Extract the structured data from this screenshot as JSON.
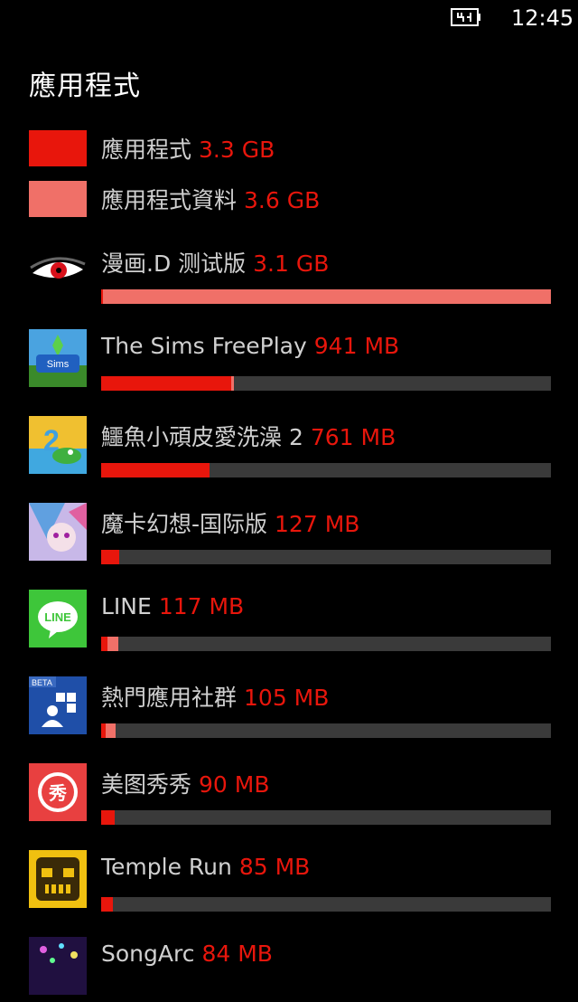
{
  "status": {
    "time": "12:45",
    "battery_icon": "battery-charging-icon"
  },
  "page": {
    "title": "應用程式"
  },
  "colors": {
    "app": "#e8160c",
    "data": "#f07068",
    "track": "#3a3a3a",
    "background": "#000000"
  },
  "legend": [
    {
      "name": "應用程式",
      "size": "3.3 GB",
      "color": "#e8160c"
    },
    {
      "name": "應用程式資料",
      "size": "3.6 GB",
      "color": "#f07068"
    }
  ],
  "apps": [
    {
      "name": "漫画.D 测试版",
      "size": "3.1 GB",
      "icon": "manga-d-eye-icon",
      "app_fraction": 0.004,
      "data_fraction": 0.996
    },
    {
      "name": "The Sims FreePlay",
      "size": "941 MB",
      "icon": "sims-freeplay-icon",
      "app_fraction": 0.29,
      "data_fraction": 0.005
    },
    {
      "name": "鱷魚小頑皮愛洗澡 2",
      "size": "761 MB",
      "icon": "wheres-my-water-icon",
      "app_fraction": 0.24,
      "data_fraction": 0.0
    },
    {
      "name": "魔卡幻想-国际版",
      "size": "127 MB",
      "icon": "magic-card-fantasy-icon",
      "app_fraction": 0.04,
      "data_fraction": 0.0
    },
    {
      "name": "LINE",
      "size": "117 MB",
      "icon": "line-icon",
      "app_fraction": 0.014,
      "data_fraction": 0.025
    },
    {
      "name": "熱門應用社群",
      "size": "105 MB",
      "icon": "app-social-beta-icon",
      "app_fraction": 0.01,
      "data_fraction": 0.022
    },
    {
      "name": "美图秀秀",
      "size": "90 MB",
      "icon": "meitu-icon",
      "app_fraction": 0.03,
      "data_fraction": 0.0
    },
    {
      "name": "Temple Run",
      "size": "85 MB",
      "icon": "temple-run-icon",
      "app_fraction": 0.027,
      "data_fraction": 0.0
    },
    {
      "name": "SongArc",
      "size": "84 MB",
      "icon": "songarc-icon",
      "app_fraction": 0.027,
      "data_fraction": 0.0
    }
  ]
}
